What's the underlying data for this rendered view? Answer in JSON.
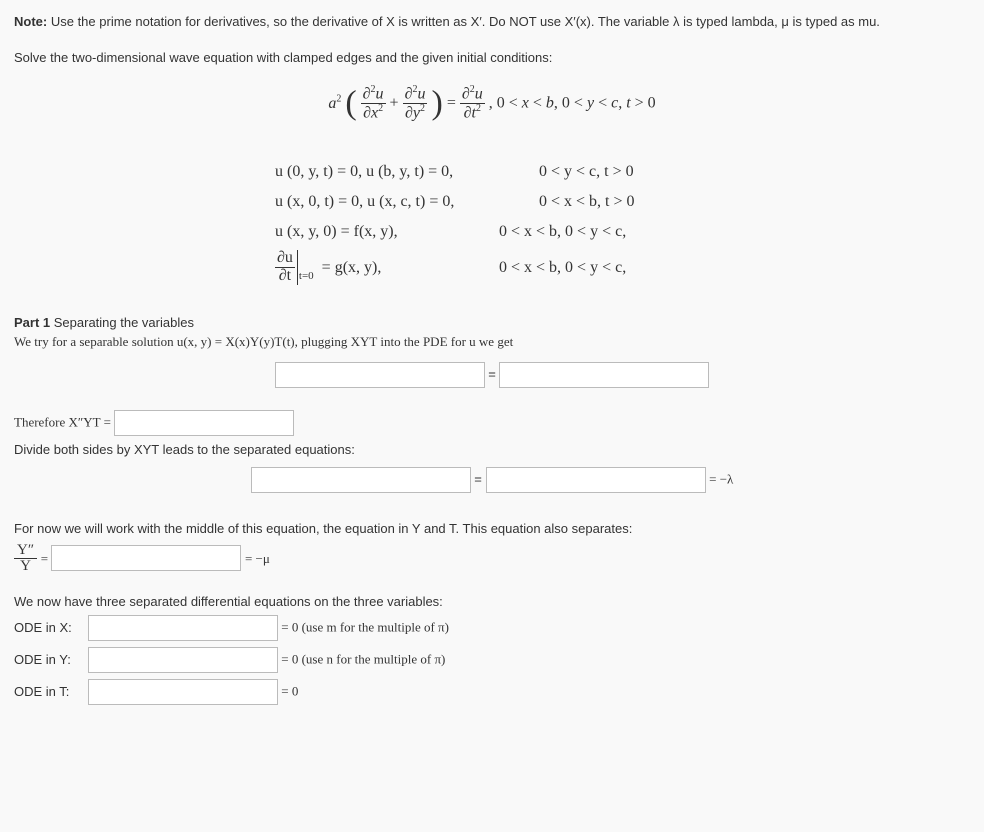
{
  "note": {
    "prefix": "Note:",
    "body": "Use the prime notation for derivatives, so the derivative of X is written as X′. Do NOT use X′(x). The variable λ is typed lambda, μ is typed as mu."
  },
  "prompt": "Solve the two-dimensional wave equation with clamped edges and the given initial conditions:",
  "pde": {
    "equation": "a² ( ∂²u/∂x² + ∂²u/∂y² ) = ∂²u/∂t² ,  0 < x < b, 0 < y < c, t > 0",
    "bc1_left": "u (0, y, t) = 0, u (b, y, t) = 0,",
    "bc1_right": "0 < y < c, t > 0",
    "bc2_left": "u (x, 0, t) = 0, u (x, c, t) = 0,",
    "bc2_right": "0 < x < b, t > 0",
    "ic1_left": "u (x, y, 0) = f(x, y),",
    "ic1_right": "0 < x < b, 0 < y < c,",
    "ic2_left_pre": "∂u",
    "ic2_left_den": "∂t",
    "ic2_left_sub": "t=0",
    "ic2_left_post": "= g(x, y),",
    "ic2_right": "0 < x < b, 0 < y < c,"
  },
  "part1": {
    "heading": "Part 1",
    "heading_rest": " Separating the variables",
    "line1": "We try for a separable solution u(x, y) = X(x)Y(y)T(t), plugging XYT into the PDE for u we get",
    "eq_equal": "=",
    "therefore_pre": "Therefore X″YT = ",
    "divide_line": "Divide both sides by XYT leads to the separated equations:",
    "sep_equal": "=",
    "sep_end": " = −λ",
    "middle_line": "For now we will work with the middle of this equation, the equation in Y and T. This equation also separates:",
    "yfrac_num": "Y″",
    "yfrac_den": "Y",
    "yfrac_eq": " = ",
    "yfrac_end": " = −μ",
    "three_sep": "We now have three separated differential equations on the three variables:",
    "ode_x_label": "ODE in X:",
    "ode_x_post": " = 0 (use m for the multiple of π)",
    "ode_y_label": "ODE in Y:",
    "ode_y_post": " = 0 (use n for the multiple of π)",
    "ode_t_label": "ODE in T:",
    "ode_t_post": " = 0"
  }
}
